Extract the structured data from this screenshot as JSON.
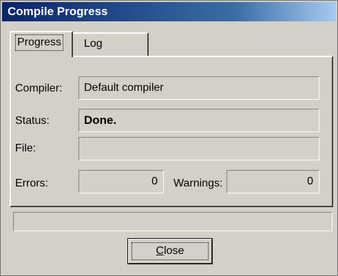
{
  "window": {
    "title": "Compile Progress"
  },
  "tabs": [
    {
      "label": "Progress",
      "active": true
    },
    {
      "label": "Log",
      "active": false
    }
  ],
  "progress_tab": {
    "compiler": {
      "label": "Compiler:",
      "value": "Default compiler"
    },
    "status": {
      "label": "Status:",
      "value": "Done."
    },
    "file": {
      "label": "File:",
      "value": ""
    },
    "errors": {
      "label": "Errors:",
      "value": "0"
    },
    "warnings": {
      "label": "Warnings:",
      "value": "0"
    }
  },
  "progress_bar": {
    "fraction": 0
  },
  "buttons": {
    "close": {
      "mnemonic": "C",
      "rest": "lose"
    }
  },
  "colors": {
    "face": "#d4d0c8",
    "title_start": "#0a246a",
    "title_end": "#a6caf0"
  }
}
